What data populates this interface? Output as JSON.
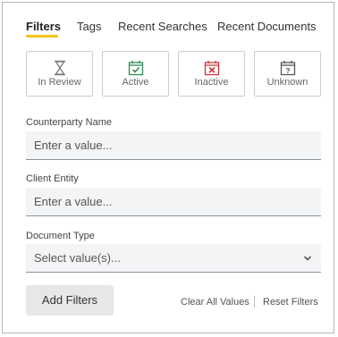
{
  "tabs": [
    {
      "label": "Filters",
      "active": true
    },
    {
      "label": "Tags",
      "active": false
    },
    {
      "label": "Recent Searches",
      "active": false
    },
    {
      "label": "Recent Documents",
      "active": false
    }
  ],
  "status_filters": [
    {
      "label": "In Review",
      "icon": "hourglass-icon",
      "color": "#7a7a7a"
    },
    {
      "label": "Active",
      "icon": "check-calendar-icon",
      "color": "#2e8b57"
    },
    {
      "label": "Inactive",
      "icon": "x-calendar-icon",
      "color": "#d13438"
    },
    {
      "label": "Unknown",
      "icon": "question-calendar-icon",
      "color": "#555555"
    }
  ],
  "fields": {
    "counterparty": {
      "label": "Counterparty Name",
      "placeholder": "Enter a value..."
    },
    "client_entity": {
      "label": "Client Entity",
      "placeholder": "Enter a value..."
    },
    "document_type": {
      "label": "Document Type",
      "placeholder": "Select value(s)..."
    }
  },
  "actions": {
    "add_filters": "Add Filters",
    "clear_all": "Clear All Values",
    "reset": "Reset Filters"
  },
  "colors": {
    "accent": "#f0c419",
    "field_bg": "#f3f4f6"
  }
}
